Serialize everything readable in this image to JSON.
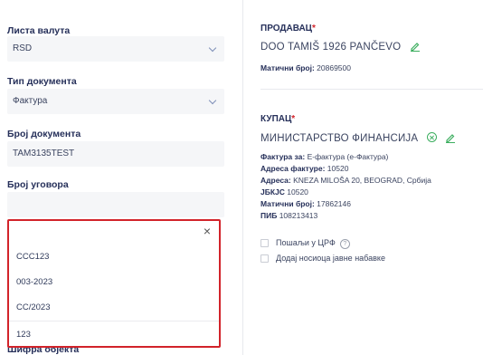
{
  "left": {
    "currency": {
      "label": "Листа валута",
      "value": "RSD"
    },
    "doc_type": {
      "label": "Тип документа",
      "value": "Фактура"
    },
    "doc_number": {
      "label": "Број документа",
      "value": "TAM3135TEST"
    },
    "contract": {
      "label": "Број уговора"
    },
    "dropdown": {
      "close": "×",
      "items": [
        "CCC123",
        "003-2023",
        "CC/2023"
      ],
      "typed_value": "123"
    },
    "next_label": "Шифра објекта"
  },
  "seller": {
    "title": "ПРОДАВАЦ",
    "required_mark": "*",
    "name": "DOO TAMIŠ 1926 PANČEVO",
    "id_label": "Матични број:",
    "id_value": "20869500"
  },
  "buyer": {
    "title": "КУПАЦ",
    "required_mark": "*",
    "name": "МИНИСТАРСТВО ФИНАНСИЈА",
    "invoice_for_label": "Фактура за:",
    "invoice_for_value": "Е-фактура (е-Фактура)",
    "invoice_address_label": "Адреса фактуре:",
    "invoice_address_value": "10520",
    "address_label": "Адреса:",
    "address_value": "KNEZA MILOŠA 20, BEOGRAD, Србија",
    "jbkjs_label": "ЈБКЈС",
    "jbkjs_value": "10520",
    "id_label": "Матични број:",
    "id_value": "17862146",
    "pib_label": "ПИБ",
    "pib_value": "108213413"
  },
  "options": {
    "send_crf": "Пошаљи у ЦРФ",
    "help": "?",
    "add_holder": "Додај носиоца јавне набавке"
  },
  "colors": {
    "accent_green": "#3cae5f",
    "highlight_red": "#d2232a",
    "text_navy": "#26305a"
  }
}
